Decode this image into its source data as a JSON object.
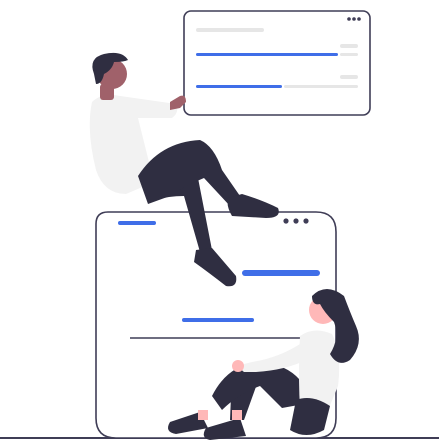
{
  "illustration": {
    "colors": {
      "accent": "#3f6ee8",
      "outline": "#3f3d56",
      "line_light": "#e6e6e6",
      "shirt": "#f2f2f2",
      "pants": "#2f2e41",
      "skin": "#a0616a",
      "skin_light": "#ffb8b8",
      "hair": "#2f2e41",
      "background": "#ffffff"
    },
    "icons": {
      "menu_dots": "three-dots-icon"
    }
  }
}
